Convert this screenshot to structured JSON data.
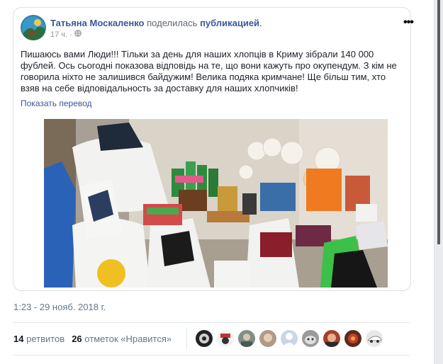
{
  "post": {
    "author": "Татьяна Москаленко",
    "action": "поделилась",
    "action_object": "публикацией",
    "period": ".",
    "time_ago": "17 ч.",
    "dot": "·",
    "text": "Пишаюсь вами Люди!!! Тільки за день для наших хлопців в Криму зібрали 140 000 фублей. Ось сьогодні показова відповідь на те, що вони кажуть про окупендум. З кім не говорила ніхто не залишився байдужим! Велика подяка кримчане! Ще більш тим, хто взяв на себе відповідальность за доставку для наших хлопчиків!",
    "translate_link": "Показать перевод",
    "more_icon": "more-dots-icon"
  },
  "tweet": {
    "timestamp": "1:23 - 29 нояб. 2018 г.",
    "retweets_count": "14",
    "retweets_label": "ретвитов",
    "likes_count": "26",
    "likes_label": "отметок «Нравится»"
  },
  "colors": {
    "link": "#385898",
    "muted": "#657786",
    "border": "#dddfe2"
  }
}
